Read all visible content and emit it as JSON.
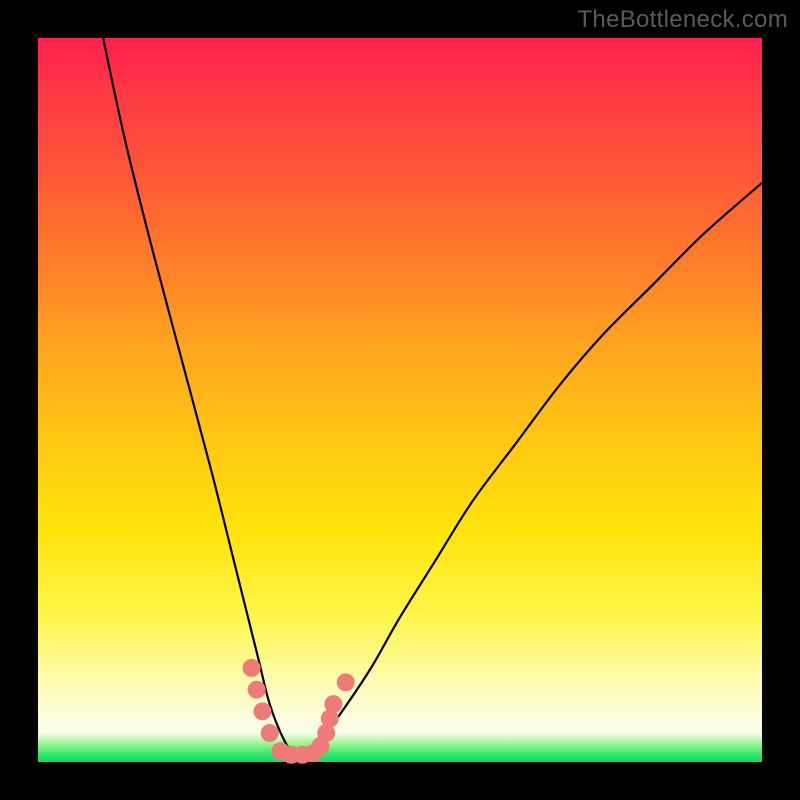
{
  "watermark": "TheBottleneck.com",
  "chart_data": {
    "type": "line",
    "title": "",
    "xlabel": "",
    "ylabel": "",
    "xlim": [
      0,
      100
    ],
    "ylim": [
      0,
      100
    ],
    "grid": false,
    "legend": false,
    "series": [
      {
        "name": "bottleneck-curve",
        "color": "#000000",
        "x": [
          9,
          12,
          16,
          20,
          24,
          27,
          29,
          30.5,
          32,
          34,
          35.5,
          37,
          39,
          42,
          46,
          50,
          55,
          60,
          66,
          72,
          78,
          85,
          92,
          100
        ],
        "y": [
          100,
          86,
          70,
          55,
          40,
          28,
          20,
          14,
          8,
          3,
          1,
          1,
          3,
          7,
          13,
          20,
          28,
          36,
          44,
          52,
          59,
          66,
          73,
          80
        ]
      }
    ],
    "markers": [
      {
        "name": "highlight-points",
        "color": "#ee7b78",
        "points": [
          {
            "x": 29.5,
            "y": 13
          },
          {
            "x": 30.2,
            "y": 10
          },
          {
            "x": 31.0,
            "y": 7
          },
          {
            "x": 32.0,
            "y": 4
          },
          {
            "x": 33.5,
            "y": 1.5
          },
          {
            "x": 35.0,
            "y": 1
          },
          {
            "x": 36.5,
            "y": 1
          },
          {
            "x": 38.0,
            "y": 1.2
          },
          {
            "x": 39.0,
            "y": 2.2
          },
          {
            "x": 39.8,
            "y": 4
          },
          {
            "x": 40.3,
            "y": 6
          },
          {
            "x": 40.8,
            "y": 8
          },
          {
            "x": 42.5,
            "y": 11
          }
        ]
      }
    ],
    "background_gradient": {
      "orientation": "vertical",
      "stops": [
        {
          "pos": 0.0,
          "color": "#ff1f4e"
        },
        {
          "pos": 0.3,
          "color": "#ff7a2a"
        },
        {
          "pos": 0.55,
          "color": "#ffc613"
        },
        {
          "pos": 0.8,
          "color": "#fff64c"
        },
        {
          "pos": 0.94,
          "color": "#fdfde0"
        },
        {
          "pos": 0.98,
          "color": "#9af58e"
        },
        {
          "pos": 1.0,
          "color": "#0fd966"
        }
      ]
    }
  }
}
